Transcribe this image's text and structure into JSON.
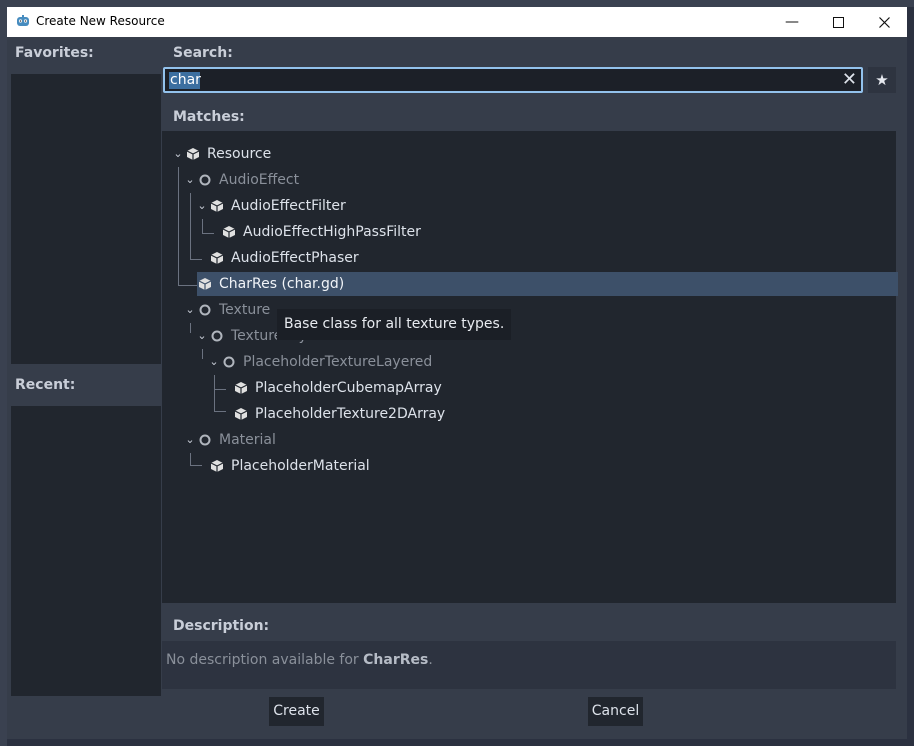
{
  "window": {
    "title": "Create New Resource"
  },
  "labels": {
    "favorites": "Favorites:",
    "recent": "Recent:",
    "search": "Search:",
    "matches": "Matches:",
    "description": "Description:"
  },
  "search": {
    "value": "char"
  },
  "tree": {
    "items": [
      {
        "label": "Resource",
        "icon": "box-icon",
        "abstract": false,
        "expanded": true
      },
      {
        "label": "AudioEffect",
        "icon": "circle-icon",
        "abstract": true,
        "expanded": true
      },
      {
        "label": "AudioEffectFilter",
        "icon": "box-icon",
        "abstract": false,
        "expanded": true
      },
      {
        "label": "AudioEffectHighPassFilter",
        "icon": "box-icon",
        "abstract": false
      },
      {
        "label": "AudioEffectPhaser",
        "icon": "box-icon",
        "abstract": false
      },
      {
        "label": "CharRes (char.gd)",
        "icon": "box-icon",
        "abstract": false,
        "selected": true
      },
      {
        "label": "Texture",
        "icon": "circle-icon",
        "abstract": true,
        "expanded": true
      },
      {
        "label": "TextureLayered",
        "icon": "circle-icon",
        "abstract": true,
        "expanded": true
      },
      {
        "label": "PlaceholderTextureLayered",
        "icon": "circle-icon",
        "abstract": true,
        "expanded": true
      },
      {
        "label": "PlaceholderCubemapArray",
        "icon": "box-icon",
        "abstract": false
      },
      {
        "label": "PlaceholderTexture2DArray",
        "icon": "box-icon",
        "abstract": false
      },
      {
        "label": "Material",
        "icon": "circle-icon",
        "abstract": true,
        "expanded": true
      },
      {
        "label": "PlaceholderMaterial",
        "icon": "box-icon",
        "abstract": false
      }
    ]
  },
  "tooltip": {
    "text": "Base class for all texture types."
  },
  "description": {
    "prefix": "No description available for ",
    "name": "CharRes",
    "suffix": "."
  },
  "buttons": {
    "create": "Create",
    "cancel": "Cancel"
  },
  "colors": {
    "accent": "#93c2ec",
    "selection": "#3d5069",
    "panel": "#21262e",
    "background": "#363d4a"
  }
}
